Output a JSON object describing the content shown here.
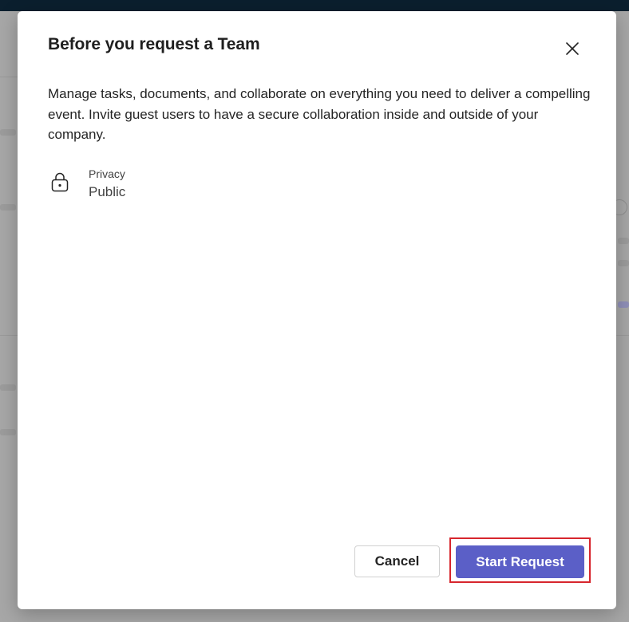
{
  "colors": {
    "primary": "#5b5fc7",
    "highlight": "#d7262d",
    "overlay": "#a7a7a7",
    "topbar": "#0b1f2e"
  },
  "dialog": {
    "title": "Before you request a Team",
    "close_icon": "close-icon",
    "description": "Manage tasks, documents, and collaborate on everything you need to deliver a compelling event. Invite guest users to have a secure collaboration inside and outside of your company.",
    "privacy": {
      "icon": "lock-icon",
      "label": "Privacy",
      "value": "Public"
    },
    "buttons": {
      "cancel_label": "Cancel",
      "start_label": "Start Request"
    }
  }
}
